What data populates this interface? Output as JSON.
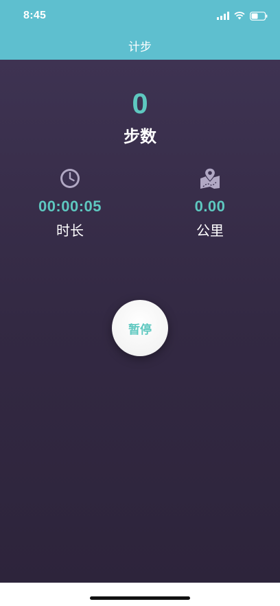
{
  "status_bar": {
    "time": "8:45"
  },
  "header": {
    "title": "计步"
  },
  "steps": {
    "value": "0",
    "label": "步数"
  },
  "duration": {
    "value": "00:00:05",
    "label": "时长",
    "icon": "clock-icon"
  },
  "distance": {
    "value": "0.00",
    "label": "公里",
    "icon": "map-pin-icon"
  },
  "pause_button": {
    "label": "暂停"
  },
  "colors": {
    "header_bg": "#5ebfcf",
    "accent": "#5ec8c0",
    "background_top": "#3e3352",
    "background_bottom": "#2d243b",
    "icon": "#b1a8c4"
  }
}
